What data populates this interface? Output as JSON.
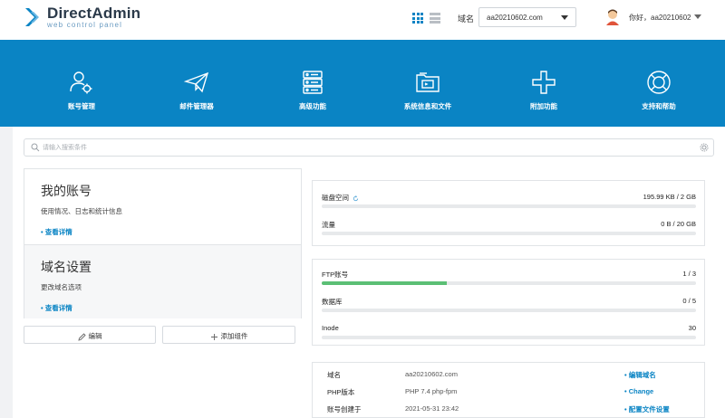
{
  "header": {
    "logo_title": "DirectAdmin",
    "logo_subtitle": "web control panel",
    "domain_label": "域名",
    "domain_selected": "aa20210602.com",
    "greeting": "你好，aa20210602"
  },
  "nav": [
    {
      "label": "账号管理",
      "icon": "user-gear-icon"
    },
    {
      "label": "邮件管理器",
      "icon": "paper-plane-icon"
    },
    {
      "label": "高级功能",
      "icon": "server-icon"
    },
    {
      "label": "系统信息和文件",
      "icon": "folder-icon"
    },
    {
      "label": "附加功能",
      "icon": "plus-icon"
    },
    {
      "label": "支持和帮助",
      "icon": "lifebuoy-icon"
    }
  ],
  "search": {
    "placeholder": "请输入搜索条件"
  },
  "account": {
    "title": "我的账号",
    "desc": "使用情况、日志和统计信息",
    "link": "• 查看详情"
  },
  "domain_settings": {
    "title": "域名设置",
    "desc": "更改域名选项",
    "link": "• 查看详情"
  },
  "buttons": {
    "edit": "编辑",
    "add": "添加组件"
  },
  "usage": {
    "disk": {
      "label": "磁盘空间",
      "value": "195.99 KB / 2 GB",
      "fraction": 0.0001
    },
    "bandwidth": {
      "label": "流量",
      "value": "0 B / 20 GB",
      "fraction": 0
    },
    "ftp": {
      "label": "FTP账号",
      "value": "1 / 3",
      "fraction": 0.333
    },
    "db": {
      "label": "数据库",
      "value": "0 / 5",
      "fraction": 0
    },
    "inode": {
      "label": "Inode",
      "value": "30",
      "fraction": 0
    }
  },
  "info": [
    {
      "key": "域名",
      "value": "aa20210602.com",
      "action": "• 编辑域名"
    },
    {
      "key": "PHP版本",
      "value": "PHP 7.4 php-fpm",
      "action": "• Change"
    },
    {
      "key": "账号创建于",
      "value": "2021-05-31 23:42",
      "action": "• 配置文件设置"
    }
  ],
  "colors": {
    "accent": "#0a84c4",
    "progress": "#5bbf75"
  }
}
